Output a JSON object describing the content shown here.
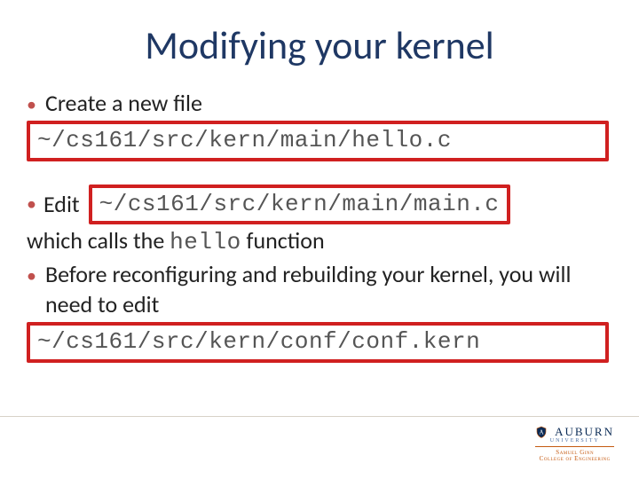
{
  "title": "Modifying your kernel",
  "bullets": {
    "create": "Create a new file",
    "edit_label": "Edit",
    "which_prefix": "which calls the ",
    "which_func": "hello",
    "which_suffix": " function",
    "before": "Before reconfiguring and rebuilding your kernel, you will need to edit"
  },
  "code": {
    "hello_c": "~/cs161/src/kern/main/hello.c",
    "main_c": "~/cs161/src/kern/main/main.c",
    "conf_kern": "~/cs161/src/kern/conf/conf.kern"
  },
  "logo": {
    "wordmark": "AUBURN",
    "uni": "UNIVERSITY",
    "college1": "Samuel Ginn",
    "college2": "College of Engineering"
  }
}
